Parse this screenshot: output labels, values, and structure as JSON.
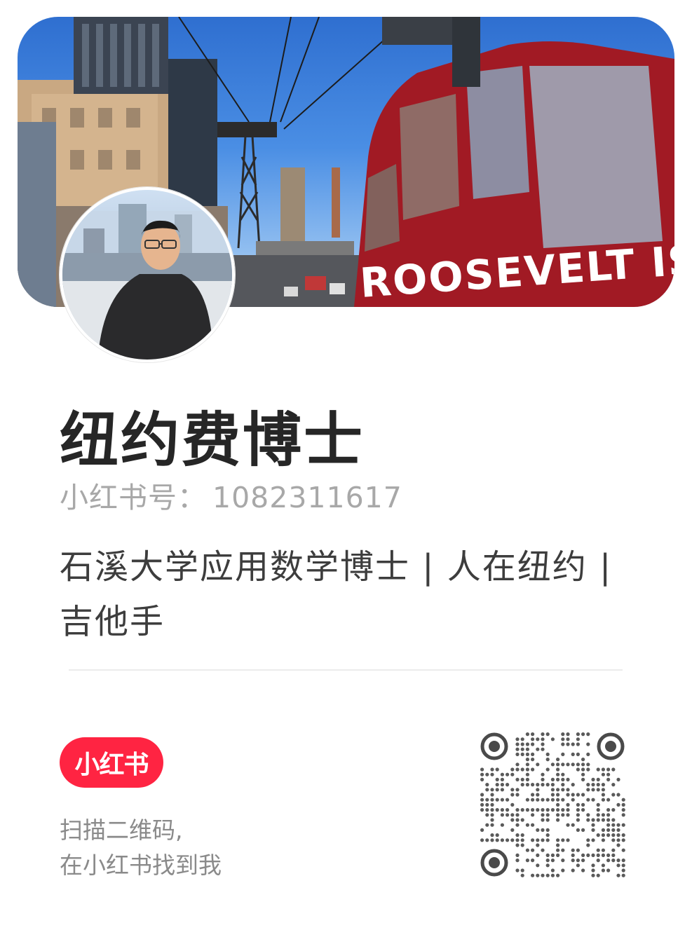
{
  "profile": {
    "name": "纽约费博士",
    "id_label": "小红书号：",
    "id_value": "1082311617",
    "bio": "石溪大学应用数学博士 | 人在纽约 | 吉他手",
    "cover_image": "roosevelt-island-tramway-photo",
    "cover_sign_text": "ROOSEVELT ISLAND",
    "avatar_image": "user-portrait-photo"
  },
  "footer": {
    "logo_text": "小红书",
    "hint_line1": "扫描二维码,",
    "hint_line2": "在小红书找到我",
    "qr_icon": "qr-code-icon"
  },
  "colors": {
    "brand": "#ff2442",
    "name_text": "#262626",
    "id_text": "#a8a8a8",
    "bio_text": "#3d3d3d",
    "hint_text": "#8a8a8a"
  }
}
